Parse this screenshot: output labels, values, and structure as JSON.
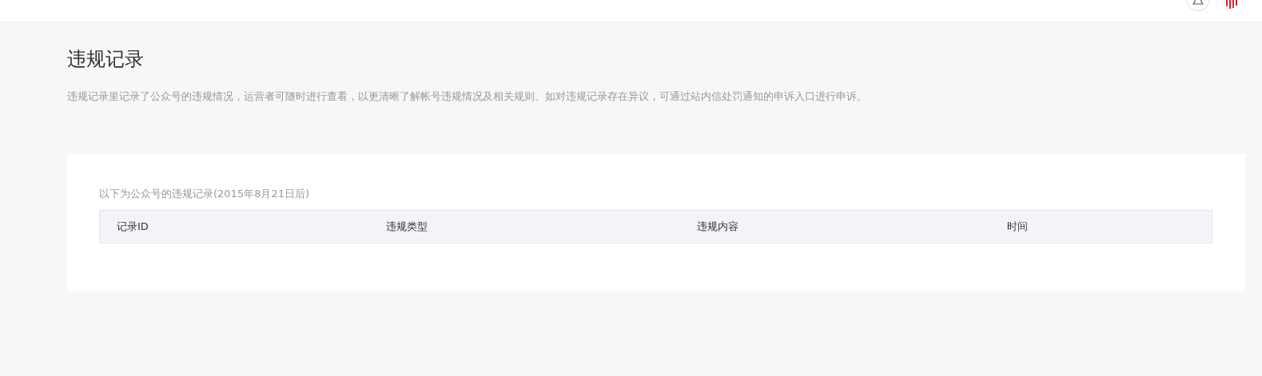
{
  "page": {
    "title": "违规记录",
    "description": "违规记录里记录了公众号的违规情况，运营者可随时进行查看，以更清晰了解帐号违规情况及相关规则。如对违规记录存在异议，可通过站内信处罚通知的申诉入口进行申诉。"
  },
  "records": {
    "caption": "以下为公众号的违规记录(2015年8月21日后)",
    "columns": [
      "记录ID",
      "违规类型",
      "违规内容",
      "时间"
    ]
  }
}
